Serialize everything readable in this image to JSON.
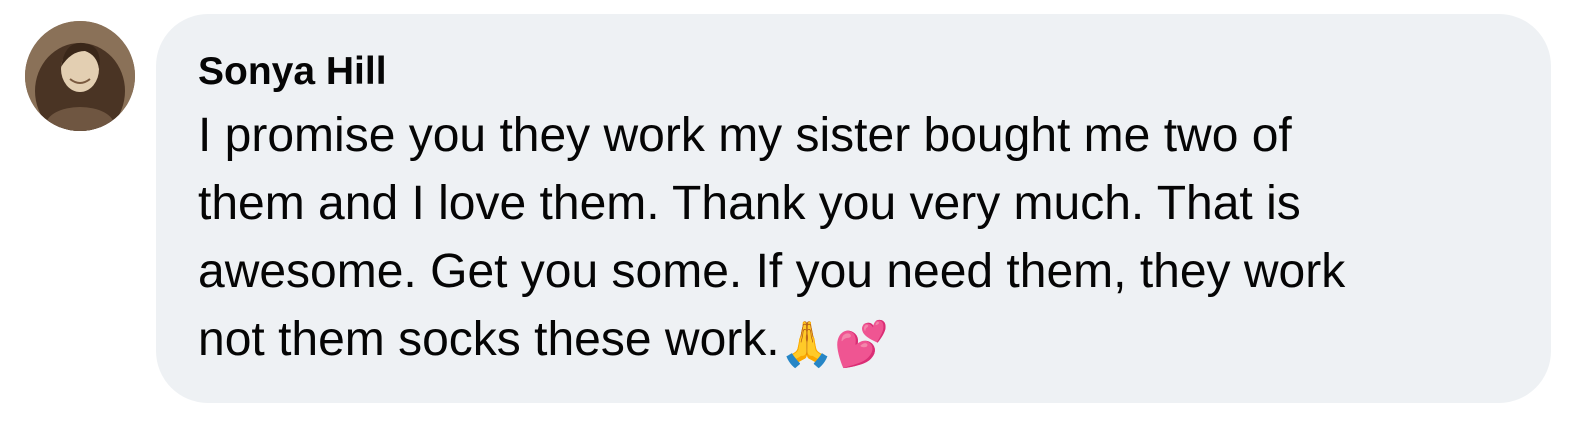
{
  "comment": {
    "author": "Sonya Hill",
    "lines": [
      "I promise you they work my sister bought me two of",
      "them and I love them. Thank you very much. That is",
      "awesome. Get you some. If you need them, they work",
      "not them socks these work."
    ],
    "emojis": {
      "pray": "🙏",
      "hearts": "💕"
    }
  },
  "icons": {
    "avatar": "profile-photo"
  }
}
